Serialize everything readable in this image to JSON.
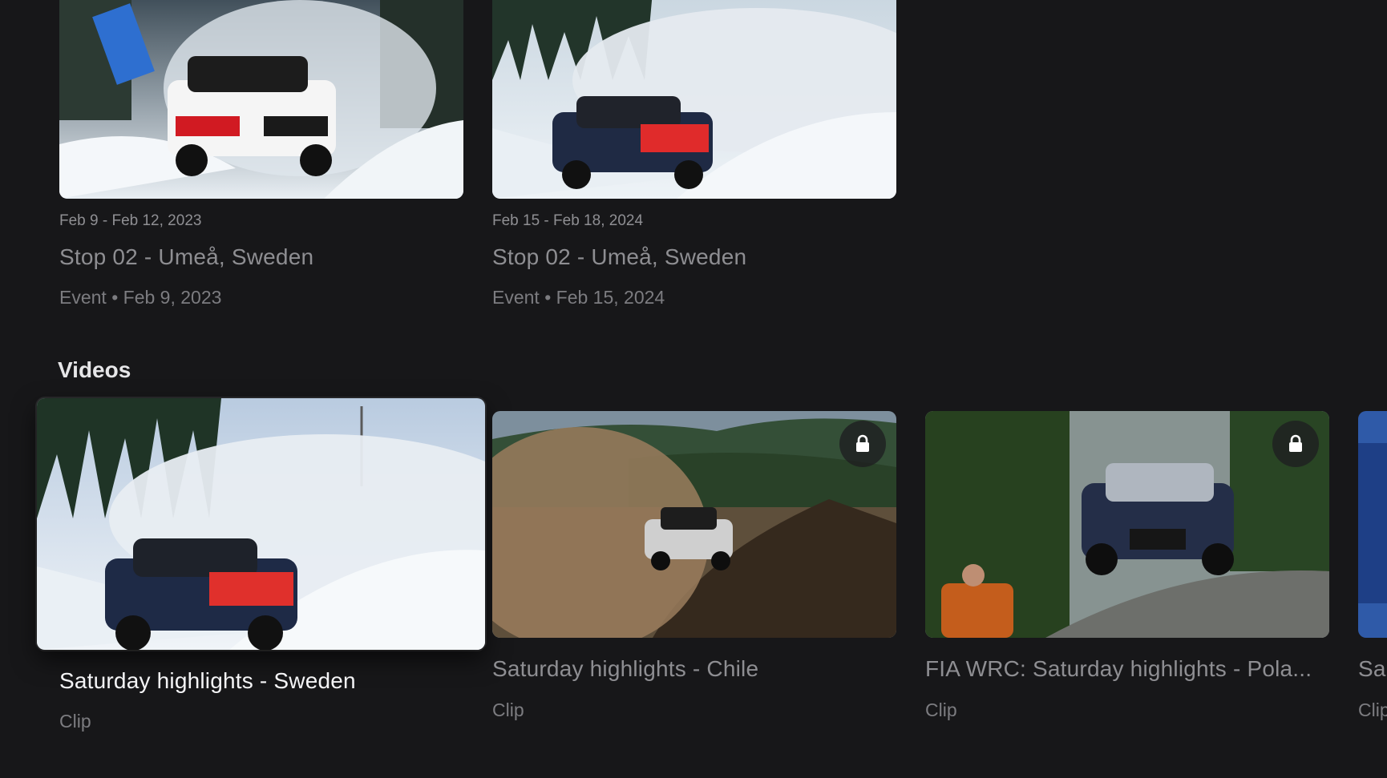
{
  "events": [
    {
      "date_range": "Feb 9 - Feb 12, 2023",
      "title": "Stop 02 - Umeå, Sweden",
      "meta": "Event • Feb 9, 2023",
      "thumbnail_icon": "rally-car-snow-image"
    },
    {
      "date_range": "Feb 15 - Feb 18, 2024",
      "title": "Stop 02 - Umeå, Sweden",
      "meta": "Event • Feb 15, 2024",
      "thumbnail_icon": "rally-car-snow-image"
    }
  ],
  "videos_section": {
    "heading": "Videos",
    "items": [
      {
        "title": "Saturday highlights - Sweden",
        "type": "Clip",
        "locked": false,
        "focused": true
      },
      {
        "title": "Saturday highlights - Chile",
        "type": "Clip",
        "locked": true,
        "focused": false
      },
      {
        "title": "FIA WRC: Saturday highlights - Pola...",
        "type": "Clip",
        "locked": true,
        "focused": false
      },
      {
        "title": "Sa",
        "type": "Clip",
        "locked": false,
        "focused": false
      }
    ]
  },
  "colors": {
    "background": "#171719",
    "focused_text": "#f4f4f6",
    "muted_text": "#8e8e92"
  },
  "icons": {
    "lock": "lock-icon"
  }
}
